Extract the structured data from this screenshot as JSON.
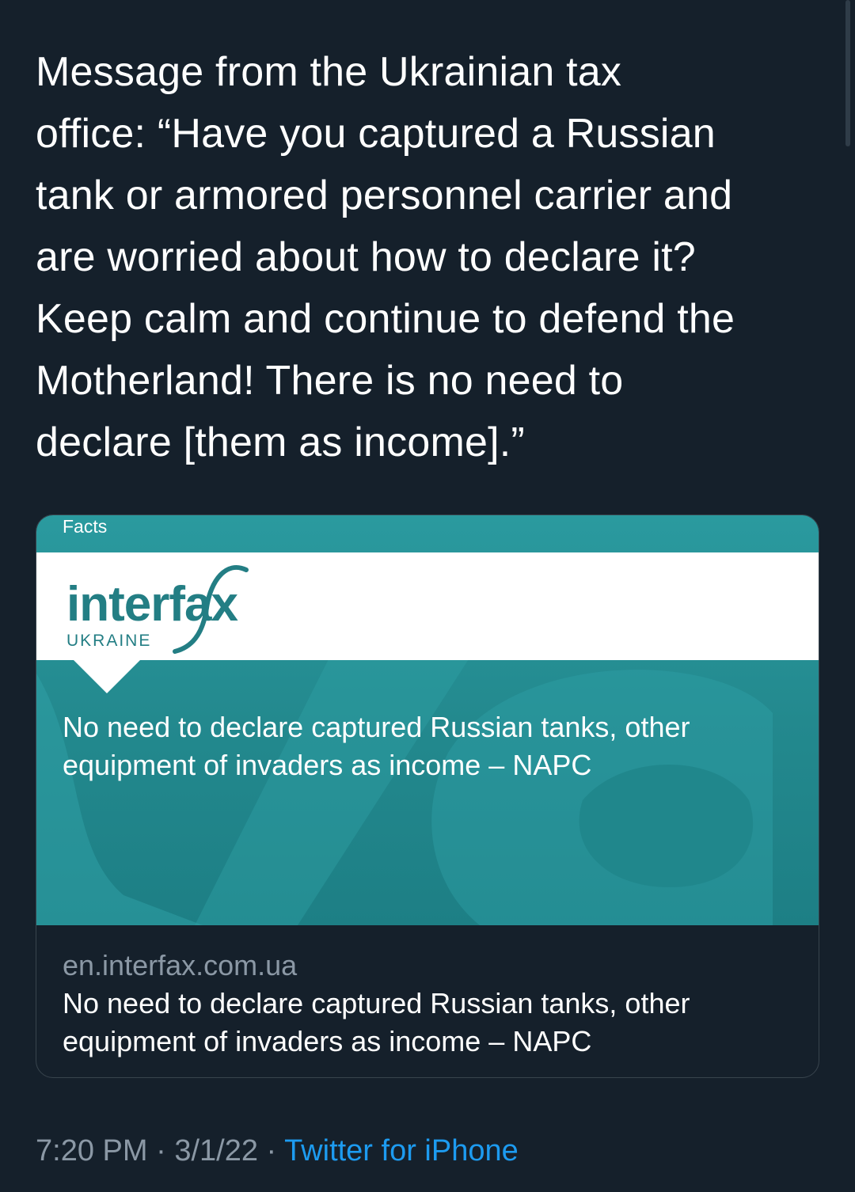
{
  "tweet": {
    "text": "Message from the Ukrainian tax\noffice: “Have you captured a Russian\ntank or armored personnel carrier and\nare worried about how to declare it?\nKeep calm and continue to defend the\nMotherland! There is no need to\ndeclare [them as income].”",
    "time": "7:20 PM",
    "date": "3/1/22",
    "separator": "·",
    "source": "Twitter for iPhone"
  },
  "card": {
    "image": {
      "section_label": "Facts",
      "logo_word": "interfax",
      "logo_subtitle": "UKRAINE",
      "headline": "No need to declare captured Russian tanks, other equipment of invaders as income – NAPC"
    },
    "domain": "en.interfax.com.ua",
    "title": "No need to declare captured Russian tanks, other equipment of invaders as income – NAPC"
  },
  "colors": {
    "background": "#15202b",
    "text": "#ffffff",
    "muted": "#8b98a5",
    "link": "#1d9bf0",
    "card_teal": "#23898e",
    "brand": "#237e84"
  }
}
